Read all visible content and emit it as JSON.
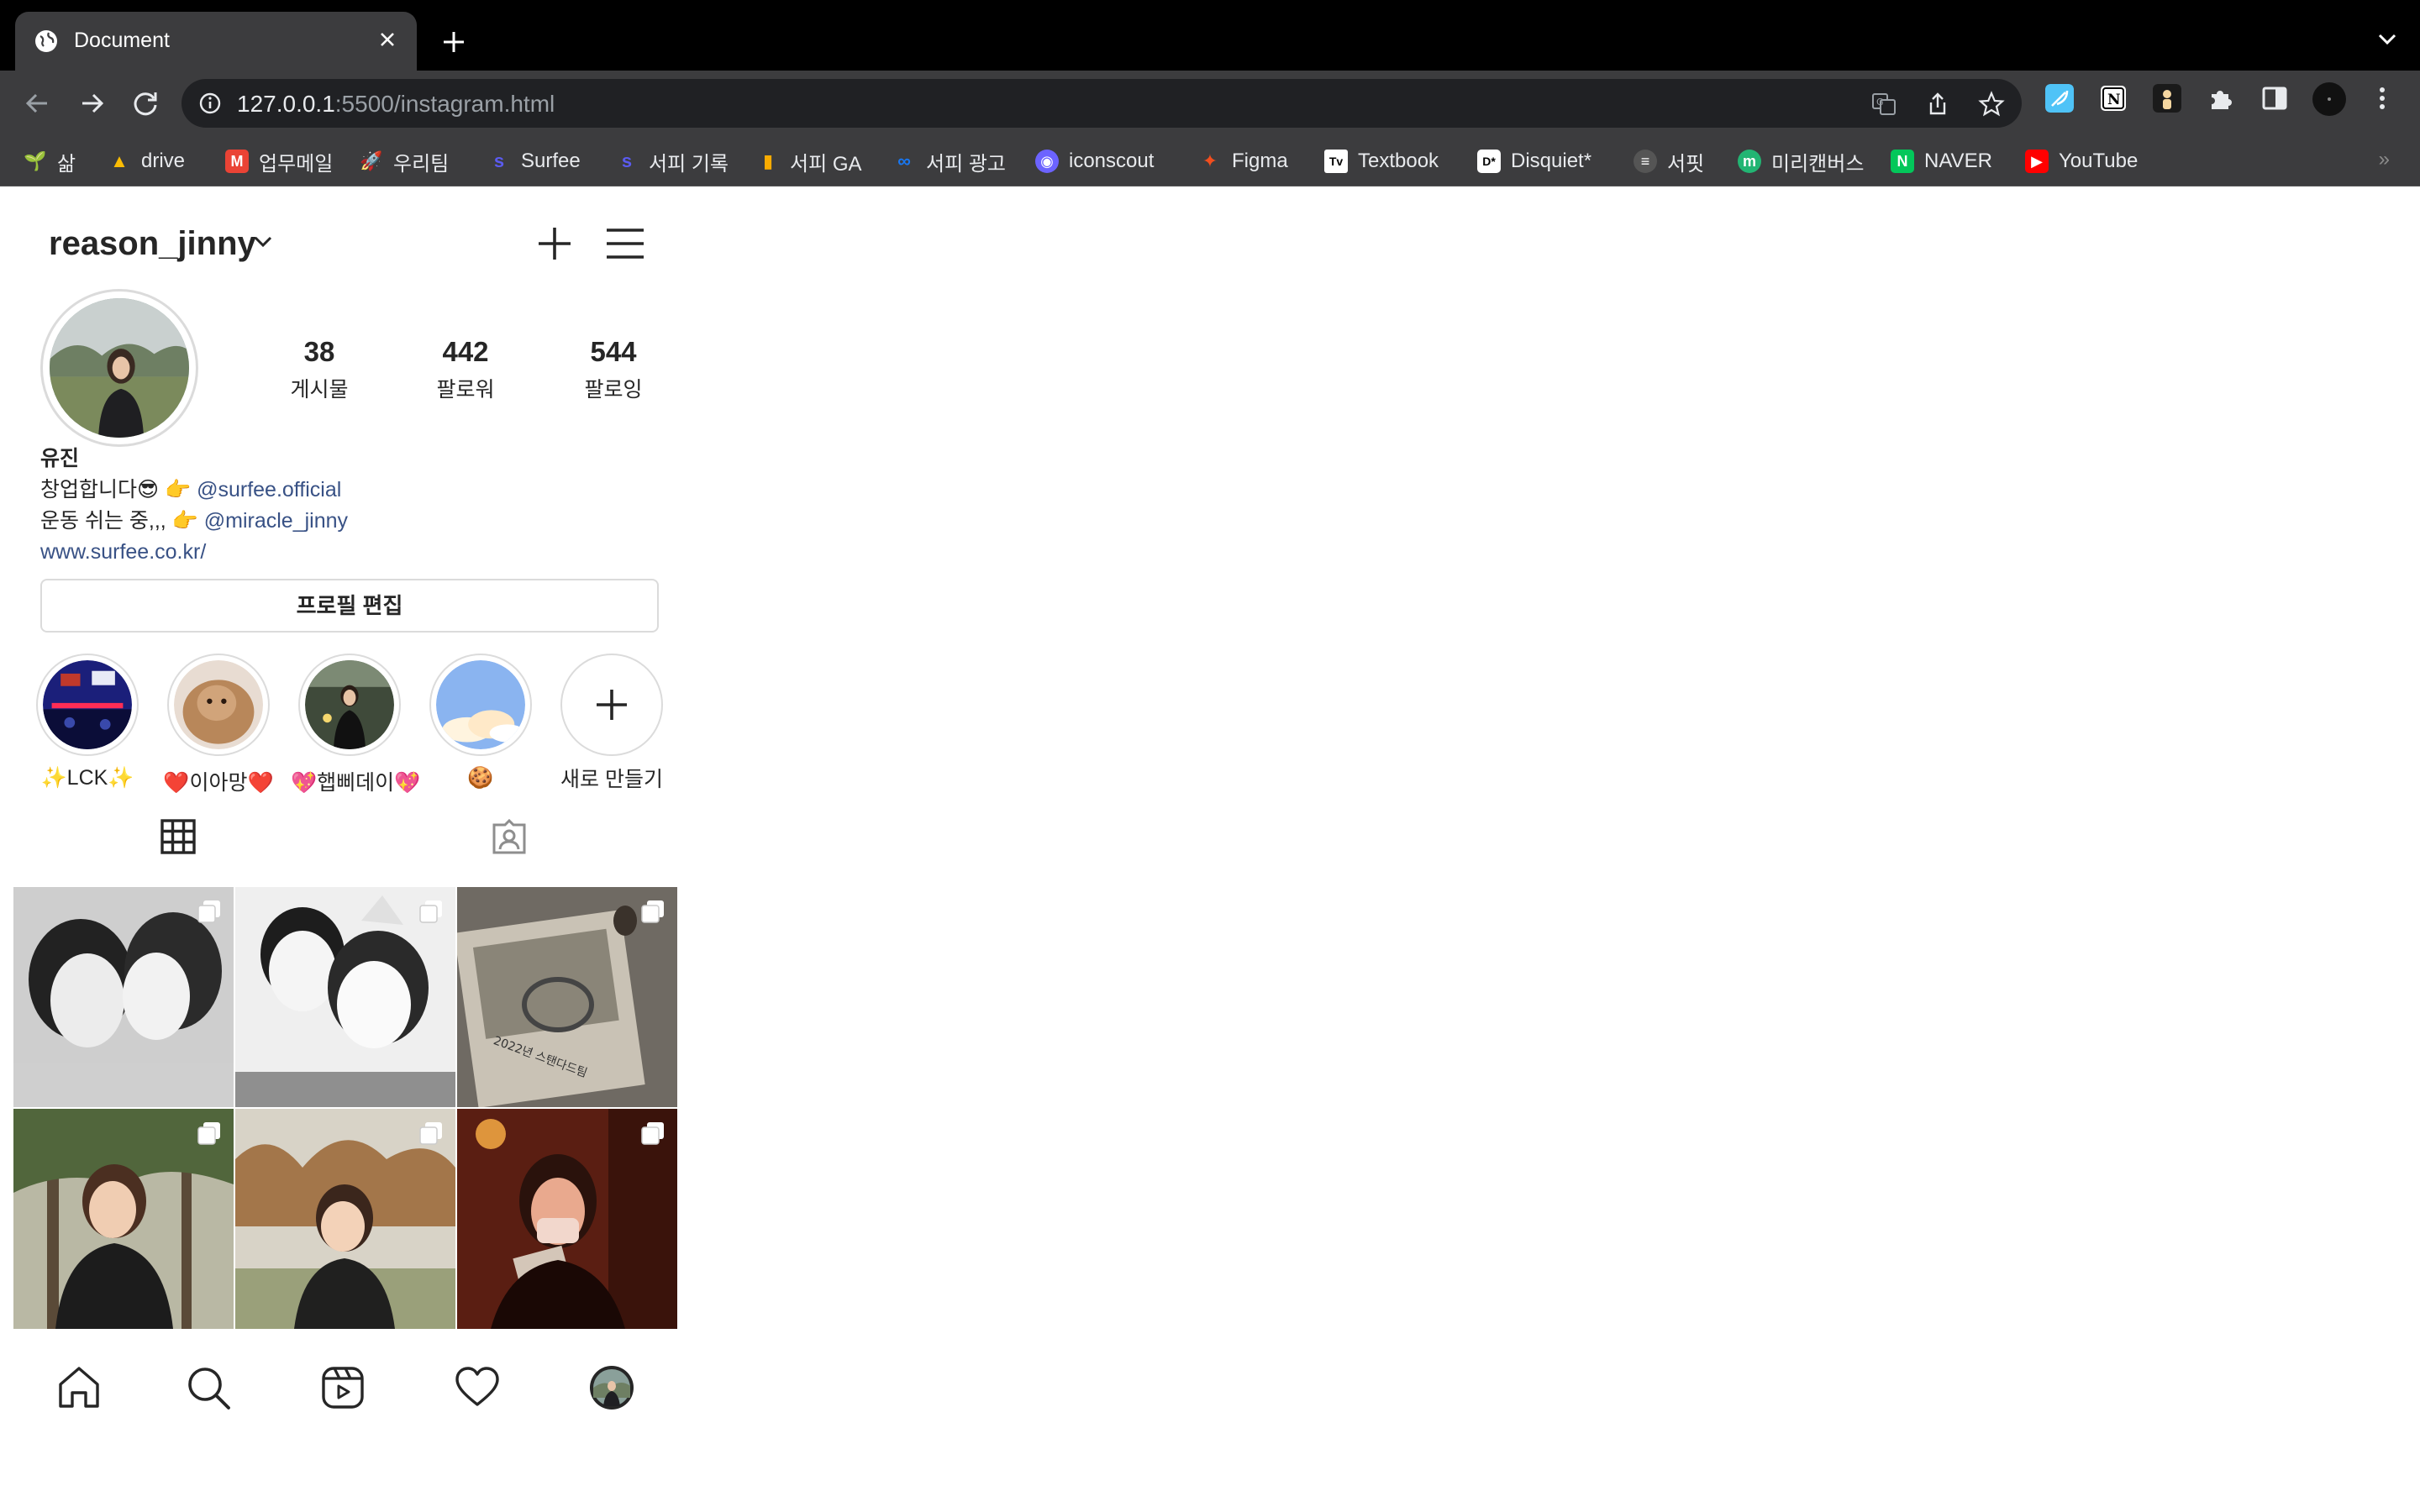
{
  "browser": {
    "tab_title": "Document",
    "url_host": "127.0.0.1",
    "url_rest": ":5500/instagram.html",
    "bookmarks": [
      {
        "label": "삶",
        "icon": "sprout-icon",
        "color": "#2e7d32"
      },
      {
        "label": "drive",
        "icon": "google-drive-icon",
        "color": "#fbbc04"
      },
      {
        "label": "업무메일",
        "icon": "gmail-icon",
        "color": "#ea4335"
      },
      {
        "label": "우리팀",
        "icon": "rocket-icon",
        "color": "#9e9e9e"
      },
      {
        "label": "Surfee",
        "icon": "surfee-icon",
        "color": "#5b5bf0"
      },
      {
        "label": "서피 기록",
        "icon": "surfee-icon",
        "color": "#5b5bf0"
      },
      {
        "label": "서피 GA",
        "icon": "analytics-icon",
        "color": "#f9ab00"
      },
      {
        "label": "서피 광고",
        "icon": "meta-icon",
        "color": "#1877f2"
      },
      {
        "label": "iconscout",
        "icon": "iconscout-icon",
        "color": "#6c63ff"
      },
      {
        "label": "Figma",
        "icon": "figma-icon",
        "color": "#f24e1e"
      },
      {
        "label": "Textbook",
        "icon": "textbook-icon",
        "color": "#111111"
      },
      {
        "label": "Disquiet*",
        "icon": "disquiet-icon",
        "color": "#ffffff"
      },
      {
        "label": "서핏",
        "icon": "surfit-icon",
        "color": "#333333"
      },
      {
        "label": "미리캔버스",
        "icon": "miricanvas-icon",
        "color": "#22b573"
      },
      {
        "label": "NAVER",
        "icon": "naver-icon",
        "color": "#03c75a"
      },
      {
        "label": "YouTube",
        "icon": "youtube-icon",
        "color": "#ff0000"
      }
    ],
    "more": "»"
  },
  "profile": {
    "username": "reason_jinny",
    "stats": [
      {
        "num": "38",
        "label": "게시물"
      },
      {
        "num": "442",
        "label": "팔로워"
      },
      {
        "num": "544",
        "label": "팔로잉"
      }
    ],
    "name": "유진",
    "bio_line1_text": "창업합니다😎 👉 ",
    "bio_line1_link": "@surfee.official",
    "bio_line2_text": "운동 쉬는 중,,, 👉 ",
    "bio_line2_link": "@miracle_jinny",
    "website": "www.surfee.co.kr/",
    "edit_button": "프로필 편집"
  },
  "highlights": [
    {
      "label": "✨LCK✨"
    },
    {
      "label": "❤️이아망❤️"
    },
    {
      "label": "💖햅삐데이💖"
    },
    {
      "label": "🍪"
    },
    {
      "label": "새로 만들기"
    }
  ],
  "accent": "#385185"
}
